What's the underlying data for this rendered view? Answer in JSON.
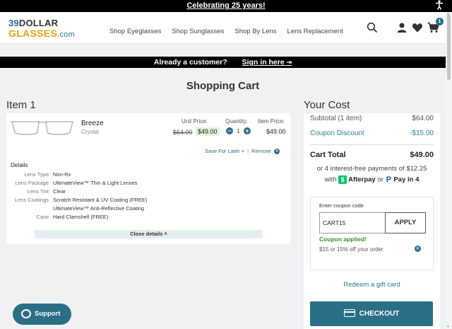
{
  "banner": {
    "text": "Celebrating 25 years!"
  },
  "logo": {
    "line1_num": "39",
    "line1_rest": "DOLLAR",
    "line2": "GLASSES",
    "line2_suffix": ".com"
  },
  "nav": [
    "Shop Eyeglasses",
    "Shop Sunglasses",
    "Shop By Lens",
    "Lens Replacement"
  ],
  "header_icons": {
    "search": "search-icon",
    "account": "user-icon",
    "wishlist": "heart-icon",
    "cart": "cart-icon",
    "cart_count": "1"
  },
  "customer_bar": {
    "text": "Already a customer?",
    "link": "Sign in here"
  },
  "page_title": "Shopping Cart",
  "item": {
    "heading": "Item 1",
    "name": "Breeze",
    "color": "Crystal",
    "unit_price_label": "Unit Price:",
    "quantity_label": "Quantity:",
    "item_price_label": "Item Price:",
    "old_price": "$64.00",
    "new_price": "$49.00",
    "quantity": "1",
    "item_price": "$49.00",
    "save_for_later": "Save For Later",
    "save_plus": "+",
    "separator": "|",
    "remove": "Remove",
    "details_title": "Details",
    "details": [
      {
        "key": "Lens Type",
        "value": "Non-Rx"
      },
      {
        "key": "Lens Package",
        "value": "UltimateView™ Thin & Light Lenses"
      },
      {
        "key": "Lens Tint",
        "value": "Clear"
      },
      {
        "key": "Lens Coatings",
        "value": "Scratch Resistant & UV Coating (FREE)"
      },
      {
        "key": "",
        "value": "UltimateView™ Anti-Reflective Coating"
      },
      {
        "key": "Case",
        "value": "Hard Clamshell (FREE)"
      }
    ],
    "close_details": "Close details ˄"
  },
  "cost": {
    "heading": "Your Cost",
    "subtotal_label": "Subtotal (1 item)",
    "subtotal_value": "$64.00",
    "discount_label": "Coupon Discount",
    "discount_value": "-$15.00",
    "total_label": "Cart Total",
    "total_value": "$49.00",
    "installments_line": "or 4 interest-free payments of $12.25",
    "with": "with",
    "afterpay": "Afterpay",
    "or": "or",
    "paypal": "Pay in 4"
  },
  "coupon": {
    "label": "Enter coupon code",
    "value": "CART15",
    "apply": "APPLY",
    "applied": "Coupon applied!",
    "description": "$15 or 15% off your order"
  },
  "gift_card_link": "Redeem a gift card",
  "checkout_label": "CHECKOUT",
  "support_label": "Support",
  "colors": {
    "brand_teal": "#2a6f85",
    "accent_orange": "#e8a20c",
    "success_green": "#3a8c2a"
  }
}
